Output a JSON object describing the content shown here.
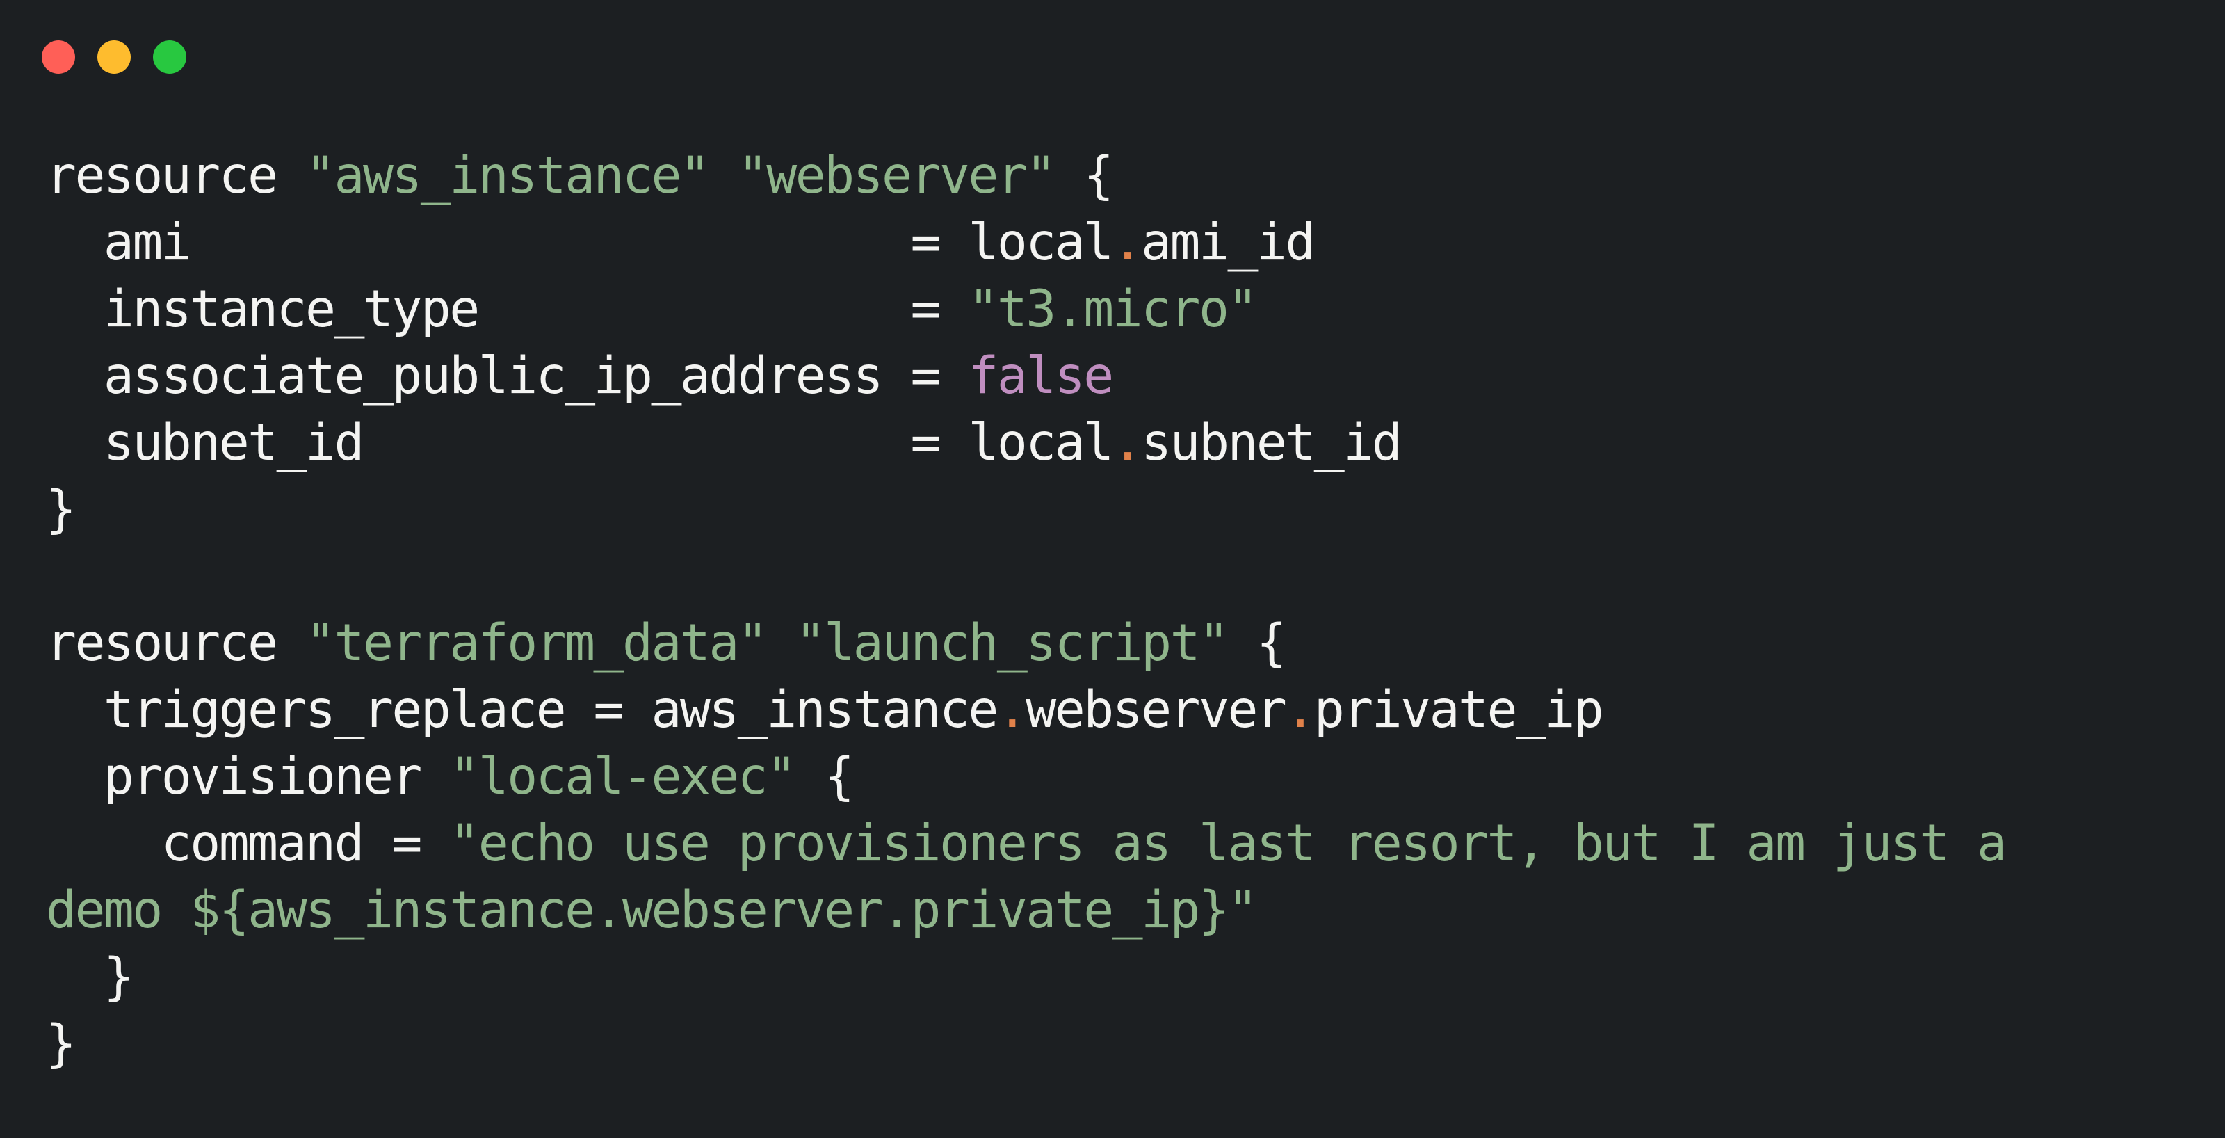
{
  "window": {
    "controls": [
      {
        "name": "close",
        "color": "#ff5f57"
      },
      {
        "name": "minimize",
        "color": "#febc2e"
      },
      {
        "name": "zoom",
        "color": "#28c840"
      }
    ]
  },
  "colors": {
    "background": "#1c1f22",
    "text": "#f4f4f2",
    "string": "#8fb58b",
    "boolean": "#c08ec0",
    "dot": "#e0814a"
  },
  "code": {
    "lines": [
      [
        {
          "t": "kw",
          "v": "resource "
        },
        {
          "t": "str",
          "v": "\"aws_instance\""
        },
        {
          "t": "plain",
          "v": " "
        },
        {
          "t": "str",
          "v": "\"webserver\""
        },
        {
          "t": "plain",
          "v": " {"
        }
      ],
      [
        {
          "t": "plain",
          "v": "  ami                         = local"
        },
        {
          "t": "dot",
          "v": "."
        },
        {
          "t": "plain",
          "v": "ami_id"
        }
      ],
      [
        {
          "t": "plain",
          "v": "  instance_type               = "
        },
        {
          "t": "str",
          "v": "\"t3.micro\""
        }
      ],
      [
        {
          "t": "plain",
          "v": "  associate_public_ip_address = "
        },
        {
          "t": "bool",
          "v": "false"
        }
      ],
      [
        {
          "t": "plain",
          "v": "  subnet_id                   = local"
        },
        {
          "t": "dot",
          "v": "."
        },
        {
          "t": "plain",
          "v": "subnet_id"
        }
      ],
      [
        {
          "t": "plain",
          "v": "}"
        }
      ],
      [
        {
          "t": "plain",
          "v": ""
        }
      ],
      [
        {
          "t": "kw",
          "v": "resource "
        },
        {
          "t": "str",
          "v": "\"terraform_data\""
        },
        {
          "t": "plain",
          "v": " "
        },
        {
          "t": "str",
          "v": "\"launch_script\""
        },
        {
          "t": "plain",
          "v": " {"
        }
      ],
      [
        {
          "t": "plain",
          "v": "  triggers_replace = aws_instance"
        },
        {
          "t": "dot",
          "v": "."
        },
        {
          "t": "plain",
          "v": "webserver"
        },
        {
          "t": "dot",
          "v": "."
        },
        {
          "t": "plain",
          "v": "private_ip"
        }
      ],
      [
        {
          "t": "plain",
          "v": "  provisioner "
        },
        {
          "t": "str",
          "v": "\"local-exec\""
        },
        {
          "t": "plain",
          "v": " {"
        }
      ],
      [
        {
          "t": "plain",
          "v": "    command = "
        },
        {
          "t": "str",
          "v": "\"echo use provisioners as last resort, but I am just a"
        }
      ],
      [
        {
          "t": "str",
          "v": "demo ${aws_instance.webserver.private_ip}\""
        }
      ],
      [
        {
          "t": "plain",
          "v": "  }"
        }
      ],
      [
        {
          "t": "plain",
          "v": "}"
        }
      ]
    ]
  }
}
